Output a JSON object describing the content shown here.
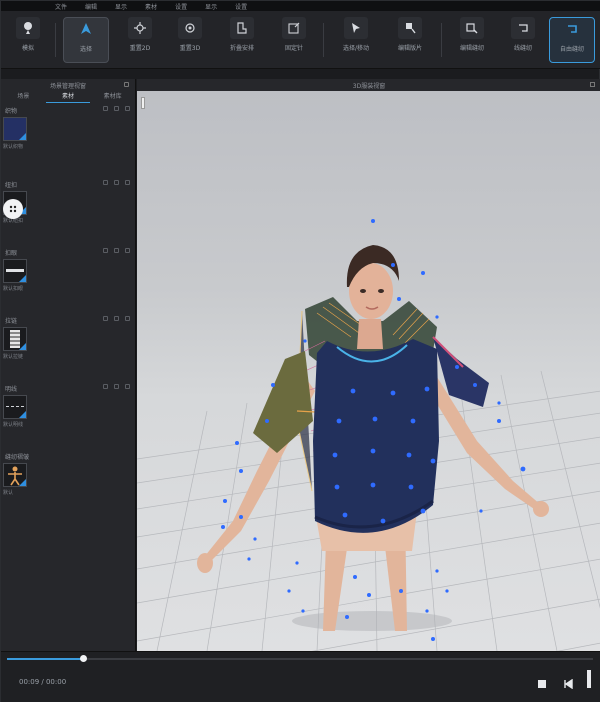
{
  "menu": [
    "文件",
    "编辑",
    "显示",
    "素材",
    "设置",
    "显示",
    "设置"
  ],
  "toolbar": {
    "tools": [
      {
        "id": "simulate",
        "label": "模拟"
      },
      {
        "id": "select",
        "label": "选择"
      },
      {
        "id": "reset2d",
        "label": "重置2D"
      },
      {
        "id": "reset3d",
        "label": "重置3D"
      },
      {
        "id": "fold",
        "label": "折叠安排"
      },
      {
        "id": "arrange",
        "label": "固定针"
      },
      {
        "id": "move",
        "label": "选择/移动"
      },
      {
        "id": "edit",
        "label": "编辑版片"
      },
      {
        "id": "seam",
        "label": "编辑缝纫"
      },
      {
        "id": "line",
        "label": "线缝纫"
      },
      {
        "id": "auto_sew",
        "label": "自由缝纫"
      }
    ]
  },
  "left_panel": {
    "title": "场景管理视窗",
    "tabs": [
      "场景",
      "素材",
      "素材库"
    ],
    "groups": [
      {
        "name": "织物",
        "caption": "默认织物"
      },
      {
        "name": "纽扣",
        "caption": "默认纽扣"
      },
      {
        "name": "扣眼",
        "caption": "默认扣眼"
      },
      {
        "name": "拉链",
        "caption": "默认拉链"
      },
      {
        "name": "明线",
        "caption": "默认明线"
      },
      {
        "name": "缝纫褶皱",
        "caption": "默认"
      }
    ]
  },
  "viewport": {
    "title": "3D服装视窗"
  },
  "playback": {
    "time": "00:09 / 00:00",
    "progress": 0.13
  },
  "colors": {
    "accent": "#3a9bdc",
    "garment": "#22305c",
    "sleeve_left": "#6b6b3e",
    "sleeve_right": "#2a3566",
    "pin": "#2f6bff"
  }
}
